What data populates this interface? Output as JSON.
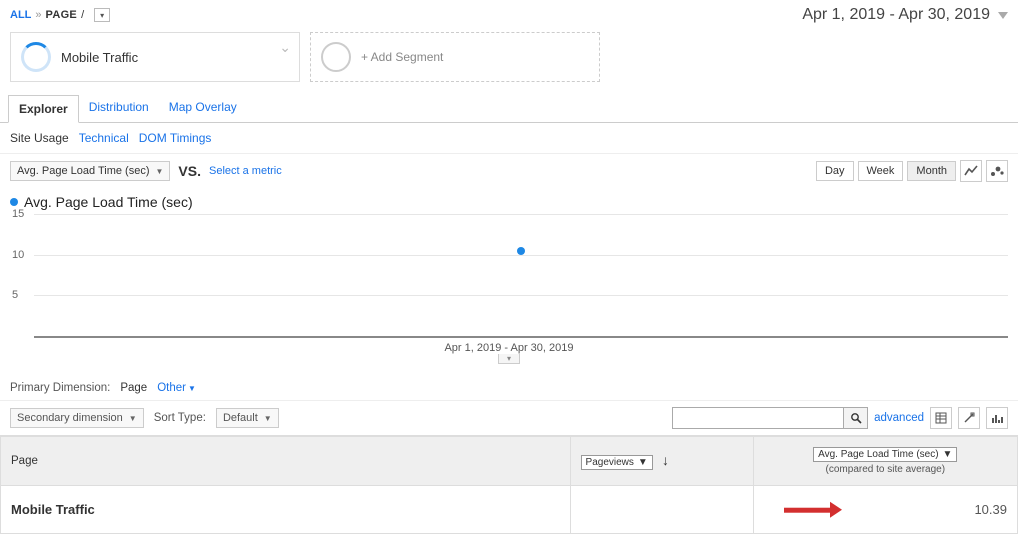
{
  "breadcrumb": {
    "all": "ALL",
    "page_label": "PAGE",
    "slash": "/"
  },
  "date_range": "Apr 1, 2019 - Apr 30, 2019",
  "segments": {
    "active": {
      "title": "Mobile Traffic"
    },
    "add": {
      "label": "+ Add Segment"
    }
  },
  "tabs": {
    "explorer": "Explorer",
    "distribution": "Distribution",
    "map_overlay": "Map Overlay"
  },
  "subtabs": {
    "site_usage": "Site Usage",
    "technical": "Technical",
    "dom_timings": "DOM Timings"
  },
  "chart_controls": {
    "metric_dd": "Avg. Page Load Time (sec)",
    "vs": "VS.",
    "select_metric": "Select a metric",
    "day": "Day",
    "week": "Week",
    "month": "Month"
  },
  "chart_title": "Avg. Page Load Time (sec)",
  "chart_footer": "Apr 1, 2019 - Apr 30, 2019",
  "chart_data": {
    "type": "line",
    "title": "Avg. Page Load Time (sec)",
    "xlabel": "",
    "ylabel": "",
    "ylim": [
      0,
      15
    ],
    "y_ticks": [
      5,
      10,
      15
    ],
    "series": [
      {
        "name": "Avg. Page Load Time (sec)",
        "x": [
          "Apr 1, 2019 - Apr 30, 2019"
        ],
        "values": [
          10.39
        ]
      }
    ]
  },
  "primary_dimension": {
    "label": "Primary Dimension:",
    "page": "Page",
    "other": "Other"
  },
  "toolbar": {
    "secondary_dimension": "Secondary dimension",
    "sort_type": "Sort Type:",
    "sort_default": "Default",
    "advanced": "advanced"
  },
  "table": {
    "col_page": "Page",
    "col_pageviews": "Pageviews",
    "col_metric": "Avg. Page Load Time (sec)",
    "compared": "(compared to site average)",
    "rows": [
      {
        "page": "Mobile Traffic",
        "metric": "10.39"
      }
    ]
  }
}
